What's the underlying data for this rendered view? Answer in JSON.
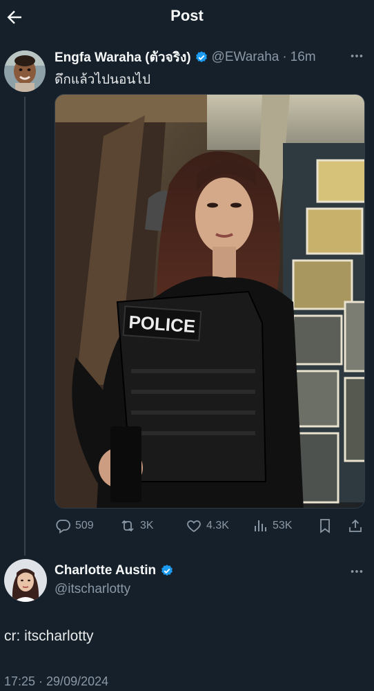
{
  "header": {
    "title": "Post"
  },
  "tweet": {
    "author_name": "Engfa Waraha (ตัวจริง)",
    "author_handle": "@EWaraha",
    "separator": "·",
    "time_ago": "16m",
    "text": "ดึกแล้วไปนอนไป",
    "media_badge_text": "POLICE",
    "stats": {
      "replies": "509",
      "reposts": "3K",
      "likes": "4.3K",
      "views": "53K"
    }
  },
  "reply_author": {
    "name": "Charlotte Austin",
    "handle": "@itscharlotty"
  },
  "caption": "cr: itscharlotty",
  "timestamp": "17:25 · 29/09/2024",
  "colors": {
    "background": "#15202b",
    "verified_blue": "#1d9bf0",
    "muted_text": "#8b98a5"
  },
  "icons": {
    "back": "arrow-left-icon",
    "more": "more-horizontal-icon",
    "verified": "verified-badge-icon",
    "reply": "reply-icon",
    "repost": "repost-icon",
    "like": "heart-icon",
    "views": "views-icon",
    "bookmark": "bookmark-icon",
    "share": "share-icon"
  }
}
